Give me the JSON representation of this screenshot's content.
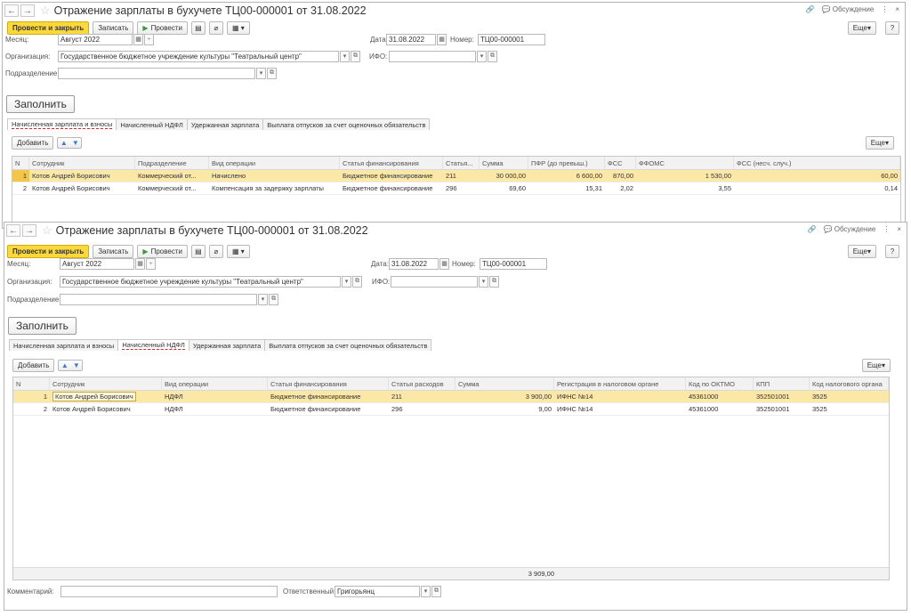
{
  "header": {
    "back": "←",
    "forward": "→",
    "star": "☆",
    "title": "Отражение зарплаты в бухучете ТЦ00-000001 от 31.08.2022",
    "link_icon": "🔗",
    "discussion": "Обсуждение",
    "more_dots": "⋮",
    "close": "×"
  },
  "toolbar": {
    "post_close": "Провести и закрыть",
    "save": "Записать",
    "post": "Провести",
    "more": "Еще",
    "help": "?"
  },
  "form": {
    "month_label": "Месяц:",
    "month_value": "Август 2022",
    "date_label": "Дата:",
    "date_value": "31.08.2022",
    "number_label": "Номер:",
    "number_value": "ТЦ00-000001",
    "org_label": "Организация:",
    "org_value": "Государственное бюджетное учреждение культуры \"Театральный центр\"",
    "ifo_label": "ИФО:",
    "ifo_value": "",
    "dept_label": "Подразделение:",
    "dept_value": "",
    "fill_button": "Заполнить",
    "comment_label": "Комментарий:",
    "comment_value": "",
    "responsible_label": "Ответственный:",
    "responsible_value": "Григорьянц"
  },
  "tabs": [
    "Начисленная зарплата и взносы",
    "Начисленный НДФЛ",
    "Удержанная зарплата",
    "Выплата отпусков за счет оценочных обязательств"
  ],
  "grid_toolbar": {
    "add": "Добавить",
    "more": "Еще"
  },
  "table1": {
    "columns": [
      "N",
      "Сотрудник",
      "Подразделение",
      "Вид операции",
      "Статья финансирования",
      "Статья...",
      "Сумма",
      "ПФР (до превыш.)",
      "ФСС",
      "ФФОМС",
      "ФСС (несч. случ.)"
    ],
    "rows": [
      [
        "1",
        "Котов Андрей Борисович",
        "Коммерческий от...",
        "Начислено",
        "Бюджетное финансирование",
        "211",
        "30 000,00",
        "6 600,00",
        "870,00",
        "1 530,00",
        "60,00"
      ],
      [
        "2",
        "Котов Андрей Борисович",
        "Коммерческий от...",
        "Компенсация за задержку зарплаты",
        "Бюджетное финансирование",
        "296",
        "69,60",
        "15,31",
        "2,02",
        "3,55",
        "0,14"
      ]
    ]
  },
  "table2": {
    "columns": [
      "N",
      "Сотрудник",
      "Вид операции",
      "Статья финансирования",
      "Статья расходов",
      "Сумма",
      "Регистрация в налоговом органе",
      "Код по ОКТМО",
      "КПП",
      "Код налогового органа"
    ],
    "rows": [
      [
        "1",
        "Котов Андрей Борисович",
        "НДФЛ",
        "Бюджетное финансирование",
        "211",
        "3 900,00",
        "ИФНС №14",
        "45361000",
        "352501001",
        "3525"
      ],
      [
        "2",
        "Котов Андрей Борисович",
        "НДФЛ",
        "Бюджетное финансирование",
        "296",
        "9,00",
        "ИФНС №14",
        "45361000",
        "352501001",
        "3525"
      ]
    ],
    "total": "3 909,00"
  }
}
